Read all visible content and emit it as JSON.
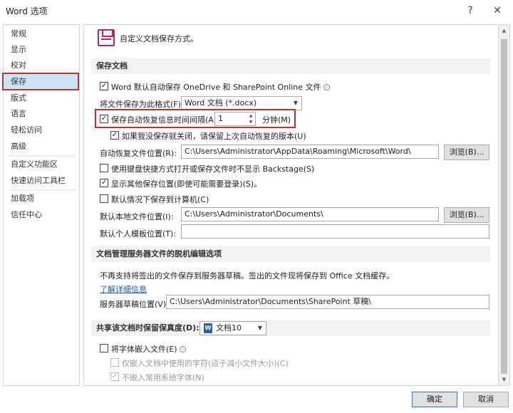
{
  "window": {
    "title": "Word 选项",
    "help": "?",
    "close": "✕"
  },
  "sidebar": {
    "items": [
      {
        "label": "常规"
      },
      {
        "label": "显示"
      },
      {
        "label": "校对"
      },
      {
        "label": "保存"
      },
      {
        "label": "版式"
      },
      {
        "label": "语言"
      },
      {
        "label": "轻松访问"
      },
      {
        "label": "高级"
      },
      {
        "label": "自定义功能区"
      },
      {
        "label": "快速访问工具栏"
      },
      {
        "label": "加载项"
      },
      {
        "label": "信任中心"
      }
    ],
    "selected": "保存"
  },
  "header": {
    "text": "自定义文档保存方式。"
  },
  "save_section": {
    "title": "保存文档",
    "autosave_onedrive": {
      "label": "Word 默认自动保存 OneDrive 和 SharePoint Online 文件",
      "checked": true
    },
    "format": {
      "label": "将文件保存为此格式(F):",
      "value": "Word 文档 (*.docx)"
    },
    "autorecover": {
      "label": "保存自动恢复信息时间间隔(A)",
      "value": "1",
      "unit": "分钟(M)",
      "checked": true
    },
    "keep_last": {
      "label": "如果我没保存就关闭，请保留上次自动恢复的版本(U)",
      "checked": true
    },
    "autorecover_location": {
      "label": "自动恢复文件位置(R):",
      "value": "C:\\Users\\Administrator\\AppData\\Roaming\\Microsoft\\Word\\",
      "browse": "浏览(B)..."
    },
    "no_backstage": {
      "label": "使用键盘快捷方式打开或保存文件时不显示 Backstage(S)",
      "checked": false
    },
    "show_more_locations": {
      "label": "显示其他保存位置(即使可能需要登录)(S)。",
      "checked": true
    },
    "save_to_computer": {
      "label": "默认情况下保存到计算机(C)",
      "checked": false
    },
    "local_location": {
      "label": "默认本地文件位置(I):",
      "value": "C:\\Users\\Administrator\\Documents\\",
      "browse": "浏览(B)..."
    },
    "template_location": {
      "label": "默认个人模板位置(T):",
      "value": ""
    }
  },
  "server_section": {
    "title": "文档管理服务器文件的脱机编辑选项",
    "note": "不再支持将签出的文件保存到服务器草稿。签出的文件现将保存到 Office 文档缓存。",
    "learn_more": "了解详细信息",
    "drafts": {
      "label": "服务器草稿位置(V):",
      "value": "C:\\Users\\Administrator\\Documents\\SharePoint 草稿\\"
    }
  },
  "fidelity_section": {
    "title": "共享该文档时保留保真度(D):",
    "doc": "文档10",
    "doc_icon": "word-doc-icon",
    "embed_fonts": {
      "label": "将字体嵌入文件(E)",
      "checked": false
    },
    "embed_used_only": {
      "label": "仅嵌入文档中使用的字符(适于减小文件大小)(C)",
      "checked": false
    },
    "no_common": {
      "label": "不嵌入常用系统字体(N)",
      "checked": true
    }
  },
  "footer": {
    "ok": "确定",
    "cancel": "取消"
  },
  "colors": {
    "accent_red": "#d9262b",
    "selected_bg": "#cce4f7",
    "link": "#1a5bb5",
    "save_icon": "#b4276a"
  }
}
